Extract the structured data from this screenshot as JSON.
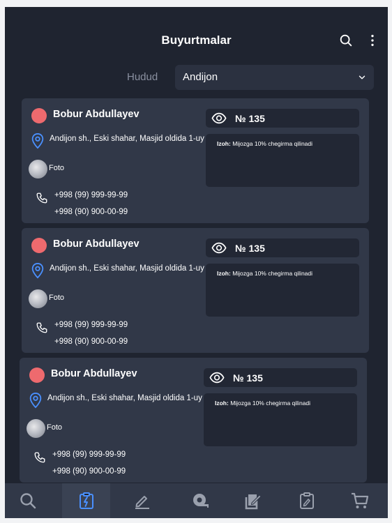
{
  "header": {
    "title": "Buyurtmalar"
  },
  "filter": {
    "label": "Hudud",
    "selected": "Andijon"
  },
  "orders": [
    {
      "name": "Bobur Abdullayev",
      "address": "Andijon sh., Eski shahar, Masjid oldida 1-uy",
      "photo_label": "Foto",
      "phones": [
        "+998 (99) 999-99-99",
        "+998 (90) 900-00-99"
      ],
      "order_number": "№ 135",
      "note_label": "Izoh:",
      "note": "Mijozga 10% chegirma qilinadi"
    },
    {
      "name": "Bobur Abdullayev",
      "address": "Andijon sh., Eski shahar, Masjid oldida 1-uy",
      "photo_label": "Foto",
      "phones": [
        "+998 (99) 999-99-99",
        "+998 (90) 900-00-99"
      ],
      "order_number": "№ 135",
      "note_label": "Izoh:",
      "note": "Mijozga 10% chegirma qilinadi"
    },
    {
      "name": "Bobur Abdullayev",
      "address": "Andijon sh., Eski shahar, Masjid oldida 1-uy",
      "photo_label": "Foto",
      "phones": [
        "+998 (99) 999-99-99",
        "+998 (90) 900-00-99"
      ],
      "order_number": "№ 135",
      "note_label": "Izoh:",
      "note": "Mijozga 10% chegirma qilinadi"
    }
  ],
  "nav": [
    {
      "icon": "search-icon",
      "active": false
    },
    {
      "icon": "clipboard-lightning-icon",
      "active": true
    },
    {
      "icon": "pencil-icon",
      "active": false
    },
    {
      "icon": "tape-measure-icon",
      "active": false
    },
    {
      "icon": "edit-document-icon",
      "active": false
    },
    {
      "icon": "clipboard-edit-icon",
      "active": false
    },
    {
      "icon": "cart-icon",
      "active": false
    }
  ],
  "colors": {
    "background": "#1f2430",
    "card": "#313848",
    "field": "#222734",
    "status_dot": "#ee6a6e",
    "accent": "#4a90ff",
    "icon": "#9aa0ad"
  }
}
